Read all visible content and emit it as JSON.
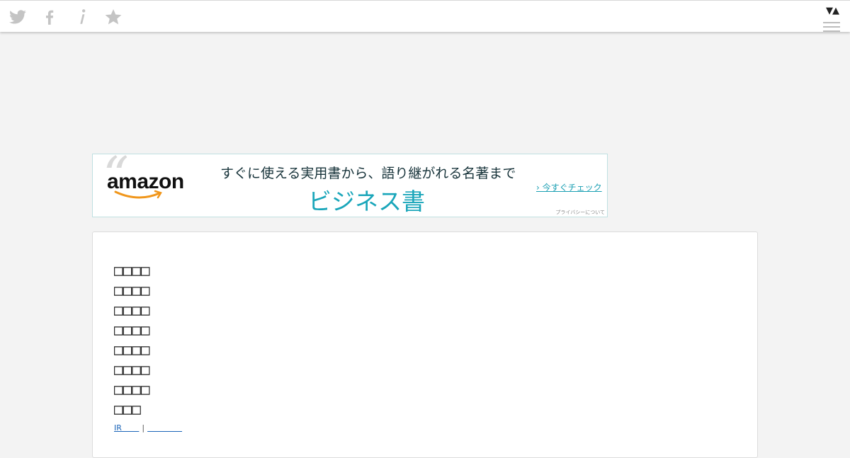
{
  "toolbar": {
    "icons": [
      "twitter-icon",
      "facebook-icon",
      "info-icon",
      "star-icon"
    ],
    "sort_toggle": "▼▲"
  },
  "colors": {
    "background": "#f3f3f3",
    "icon_gray": "#c4c4c4",
    "ad_accent": "#1aa6ba",
    "link": "#1a64b8"
  },
  "ad": {
    "quote_mark": "“",
    "logo_text": "amazon",
    "headline": "すぐに使える実用書から、語り継がれる名著まで",
    "main_text": "ビジネス書",
    "cta": "› 今すぐチェック",
    "privacy": "プライバシーについて"
  },
  "content": {
    "lines": [
      "□□□□",
      "□□□□",
      "□□□□",
      "□□□□",
      "□□□□",
      "□□□□",
      "□□□□",
      "□□□"
    ],
    "footer_link_1": "IR       ",
    "footer_sep": "|",
    "footer_link_2": "              "
  }
}
